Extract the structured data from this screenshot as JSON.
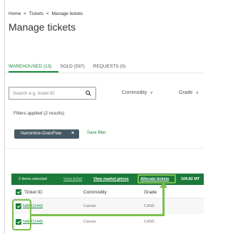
{
  "breadcrumb": {
    "home": "Home",
    "sep1": "<",
    "tickets": "Tickets",
    "sep2": "<",
    "current": "Manage tickets"
  },
  "page": {
    "title": "Manage tickets"
  },
  "tabs": [
    {
      "label": "WAREHOUSED (13)",
      "active": true
    },
    {
      "label": "SOLD (597)",
      "active": false
    },
    {
      "label": "REQUESTS (0)",
      "active": false
    }
  ],
  "search": {
    "placeholder": "Search e.g. ticket ID",
    "icon": "search-icon"
  },
  "dropdowns": {
    "commodity": "Commodity",
    "grade": "Grade",
    "chevron": "∨"
  },
  "filters": {
    "applied_label": "Filters applied (2 results)",
    "chip_label": "Narromine-GrainFlow",
    "chip_close": "×",
    "save_filter": "Save filter"
  },
  "action_bar": {
    "selected": "2 items selected",
    "view_ticket": "View ticket",
    "view_market_prices": "View market prices",
    "allocate_tickets": "Allocate tickets",
    "tonnage": "109.82 MT",
    "highlight_color": "#7cc04f",
    "bar_color": "#1b7a3a"
  },
  "table": {
    "headers": [
      "Ticket ID",
      "Commodity",
      "Grade"
    ],
    "rows": [
      {
        "ticket_id": "NARO1443",
        "commodity": "Canola",
        "grade": "CAN5",
        "checked": true
      },
      {
        "ticket_id": "NARO1445",
        "commodity": "Canola",
        "grade": "CAN5",
        "checked": true
      }
    ]
  }
}
